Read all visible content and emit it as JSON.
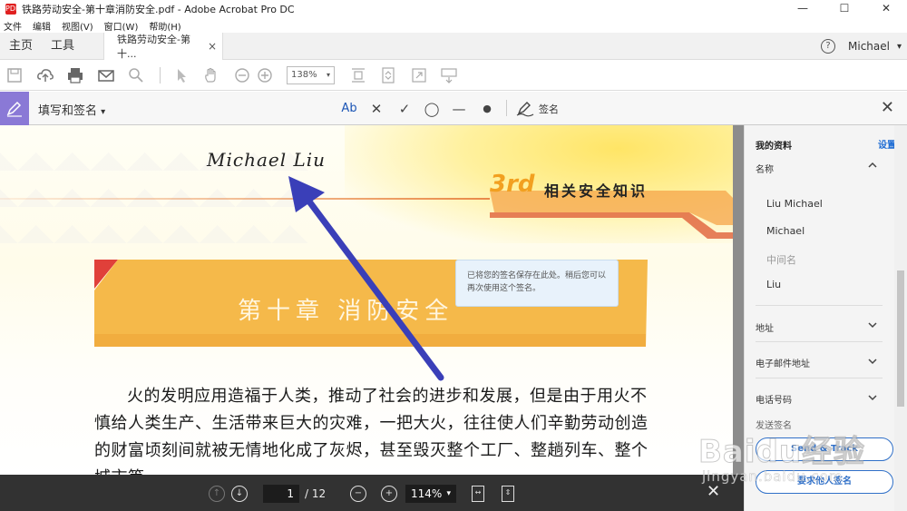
{
  "window": {
    "title": "铁路劳动安全-第十章消防安全.pdf - Adobe Acrobat Pro DC",
    "app_icon": "PDF",
    "minimize": "—",
    "maximize": "☐",
    "close": "✕"
  },
  "menu": {
    "items": [
      "文件",
      "编辑",
      "视图(V)",
      "窗口(W)",
      "帮助(H)"
    ]
  },
  "tabs": {
    "home": "主页",
    "tools": "工具",
    "doc": "铁路劳动安全-第十...",
    "doc_close": "×",
    "help": "?",
    "user": "Michael",
    "user_caret": "▾"
  },
  "toolbar": {
    "zoom": "138%",
    "zoom_caret": "▾"
  },
  "fill_sign": {
    "mode_label": "填写和签名",
    "mode_caret": "▾",
    "text_tool": "Ab",
    "cross_tool": "✕",
    "check_tool": "✓",
    "ellipse_tool": "◯",
    "line_tool": "—",
    "dot_tool": "●",
    "sign_label": "签名",
    "close": "✕"
  },
  "tooltip": {
    "text": "已将您的签名保存在此处。稍后您可以再次使用这个签名。"
  },
  "document": {
    "signature": "Michael Liu",
    "kicker_num": "3rd",
    "kicker": "相关安全知识",
    "chapter_title": "第十章  消防安全",
    "body": "火的发明应用造福于人类，推动了社会的进步和发展，但是由于用火不慎给人类生产、生活带来巨大的灾难，一把大火，往往使人们辛勤劳动创造的财富顷刻间就被无情地化成了灰烬，甚至毁灭整个工厂、整趟列车、整个城市等。"
  },
  "right_panel": {
    "title": "我的资料",
    "settings": "设置",
    "name_section": "名称",
    "name_items": [
      "Liu Michael",
      "Michael",
      "中间名",
      "Liu"
    ],
    "address_section": "地址",
    "email_section": "电子邮件地址",
    "phone_section": "电话号码",
    "send_section": "发送签名",
    "btn_send": "Send & Track",
    "btn_request": "要求他人签名"
  },
  "page_nav": {
    "current_page": "1",
    "total": "/ 12",
    "zoom": "114%",
    "zoom_caret": "▾",
    "close": "✕"
  },
  "watermark": {
    "main": "Baidu经验",
    "sub": "jingyan.baidu.com"
  },
  "colors": {
    "accent_purple": "#8a79d6",
    "arrow_blue": "#3a3fb8",
    "link_blue": "#1b6ad3",
    "banner_orange": "#f5b94a",
    "dark_bar": "#323232"
  }
}
